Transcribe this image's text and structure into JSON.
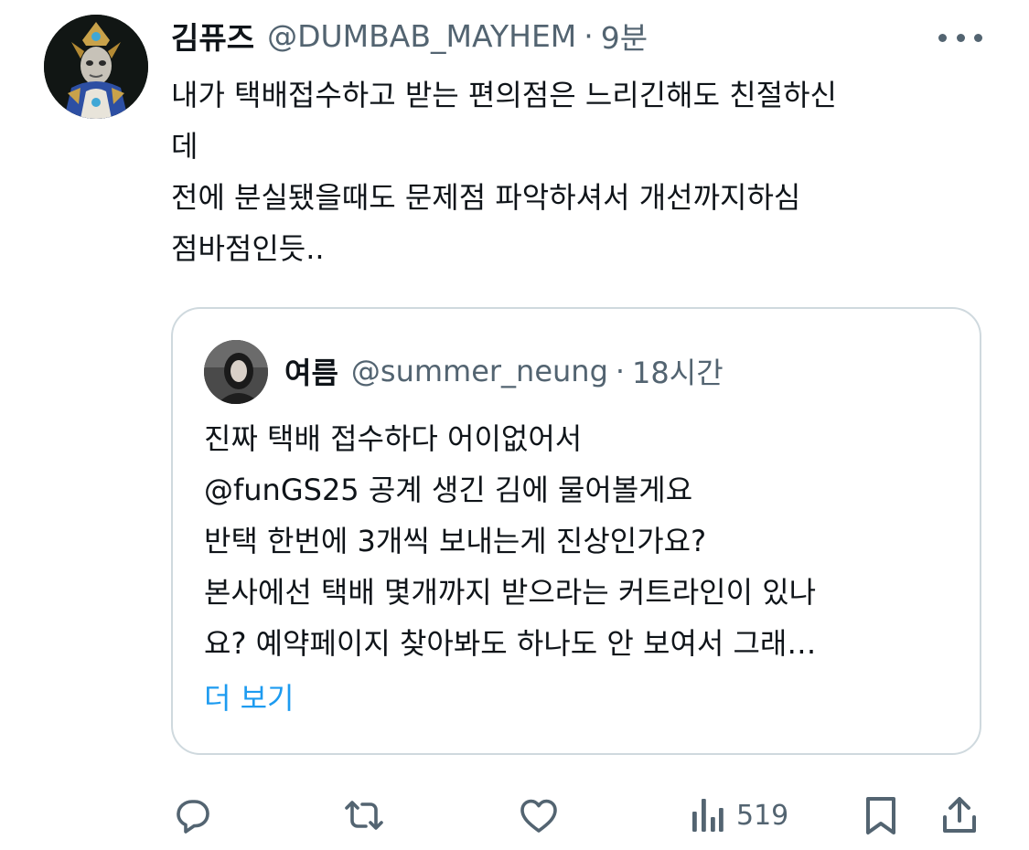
{
  "tweet": {
    "author": {
      "display_name": "김퓨즈",
      "handle": "@DUMBAB_MAYHEM",
      "separator": "·",
      "time": "9분"
    },
    "text_lines": [
      "내가 택배접수하고 받는 편의점은 느리긴해도 친절하신",
      "데",
      "전에 분실됐을때도 문제점 파악하셔서 개선까지하심",
      "점바점인듯.."
    ]
  },
  "quoted_tweet": {
    "author": {
      "display_name": "여름",
      "handle": "@summer_neung",
      "separator": "·",
      "time": "18시간"
    },
    "text_lines": [
      "진짜 택배 접수하다 어이없어서",
      "@funGS25 공계 생긴 김에 물어볼게요",
      "반택 한번에 3개씩 보내는게 진상인가요?",
      "본사에선 택배 몇개까지 받으라는 커트라인이 있나",
      "요? 예약페이지 찾아봐도 하나도 안 보여서 그래…"
    ],
    "show_more": "더 보기"
  },
  "actions": {
    "reply_icon": "reply-icon",
    "retweet_icon": "retweet-icon",
    "like_icon": "heart-icon",
    "views_icon": "views-icon",
    "views_count": "519",
    "bookmark_icon": "bookmark-icon",
    "share_icon": "share-icon"
  },
  "colors": {
    "text_primary": "#0f1419",
    "text_secondary": "#536471",
    "link": "#1d9bf0",
    "border": "#cfd9de"
  }
}
